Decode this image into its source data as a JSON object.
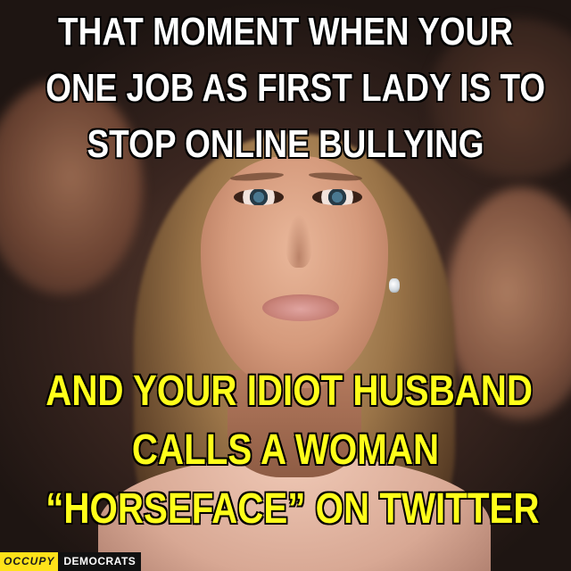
{
  "meme": {
    "top_lines": [
      "THAT MOMENT WHEN YOUR",
      "ONE JOB AS FIRST LADY IS TO",
      "STOP ONLINE BULLYING"
    ],
    "bottom_lines": [
      "AND YOUR IDIOT HUSBAND",
      "CALLS A WOMAN",
      "“HORSEFACE” ON TWITTER"
    ],
    "top_text_color": "#ffffff",
    "bottom_text_color": "#ffff1a"
  },
  "watermark": {
    "part1": "OCCUPY",
    "part2": "DEMOCRATS",
    "part1_bg": "#ffe21a",
    "part2_bg": "#111111"
  }
}
